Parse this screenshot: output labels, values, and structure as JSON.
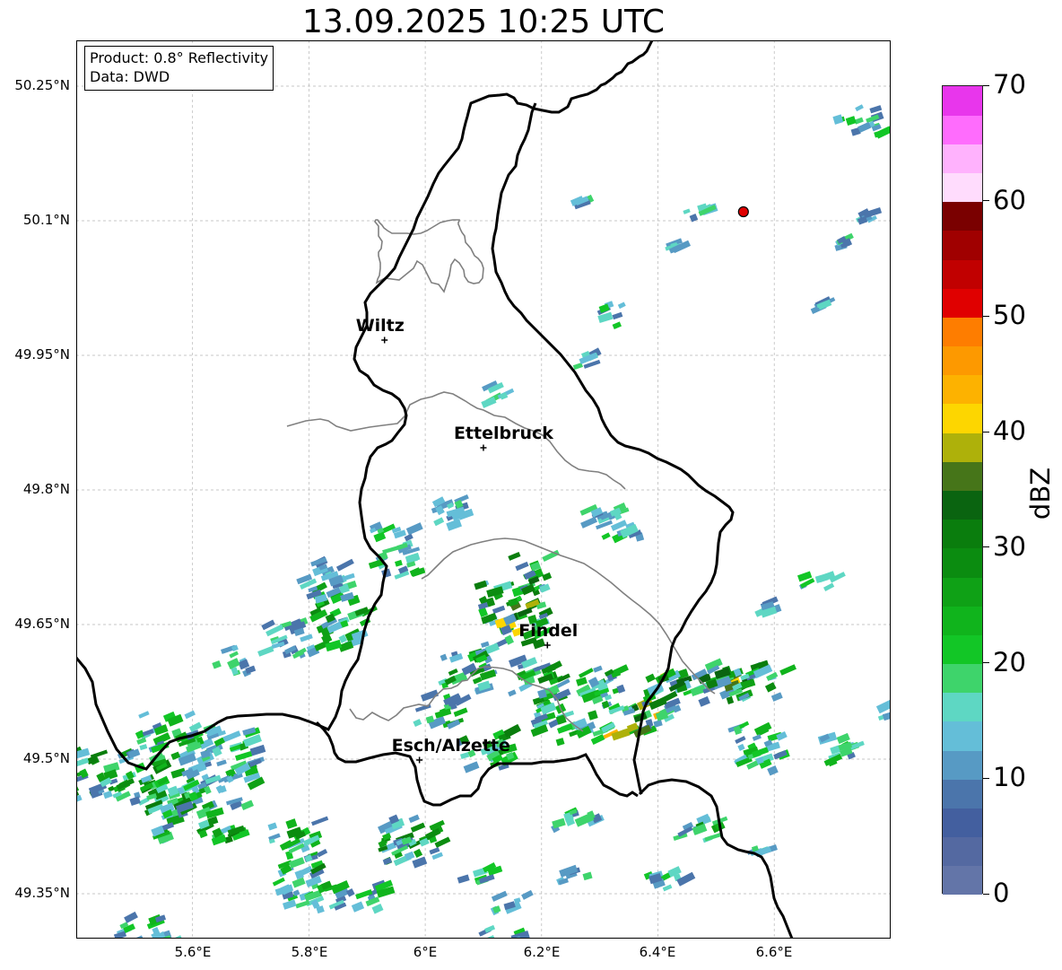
{
  "title": "13.09.2025 10:25 UTC",
  "info": {
    "product": "Product: 0.8° Reflectivity",
    "source": "Data: DWD"
  },
  "lat_ticks": [
    "50.25°N",
    "50.1°N",
    "49.95°N",
    "49.8°N",
    "49.65°N",
    "49.5°N",
    "49.35°N"
  ],
  "lon_ticks": [
    "5.6°E",
    "5.8°E",
    "6°E",
    "6.2°E",
    "6.4°E",
    "6.6°E"
  ],
  "cities": [
    {
      "name": "Wiltz",
      "lon": 5.93,
      "lat": 49.967
    },
    {
      "name": "Ettelbruck",
      "lon": 6.1,
      "lat": 49.847
    },
    {
      "name": "Findel",
      "lon": 6.21,
      "lat": 49.627
    },
    {
      "name": "Esch/Alzette",
      "lon": 5.99,
      "lat": 49.499
    }
  ],
  "radar_site": {
    "lon": 6.547,
    "lat": 50.11,
    "color": "#e00000"
  },
  "colorbar": {
    "label": "dBZ",
    "min": 0,
    "max": 70,
    "step": 2.5,
    "tick_labels": [
      "0",
      "10",
      "20",
      "30",
      "40",
      "50",
      "60",
      "70"
    ],
    "colors": [
      "#6375a8",
      "#5469a1",
      "#435f9f",
      "#4b75ab",
      "#579ac4",
      "#64bed8",
      "#5ed7c3",
      "#3ed46b",
      "#12c626",
      "#10b41c",
      "#0fa116",
      "#0b8c10",
      "#0a7d0d",
      "#0a6410",
      "#467519",
      "#aeb10a",
      "#fdd600",
      "#fdb200",
      "#fd9900",
      "#fe7d00",
      "#e00000",
      "#c10000",
      "#a00000",
      "#7a0000",
      "#ffdcfd",
      "#ffb2fd",
      "#ff6cfd",
      "#e836ec"
    ]
  },
  "map": {
    "lon_range": [
      5.4,
      6.8
    ],
    "lat_range": [
      49.3,
      50.3
    ],
    "border_color": "#000000",
    "canton_color": "#808080",
    "grid": true
  }
}
